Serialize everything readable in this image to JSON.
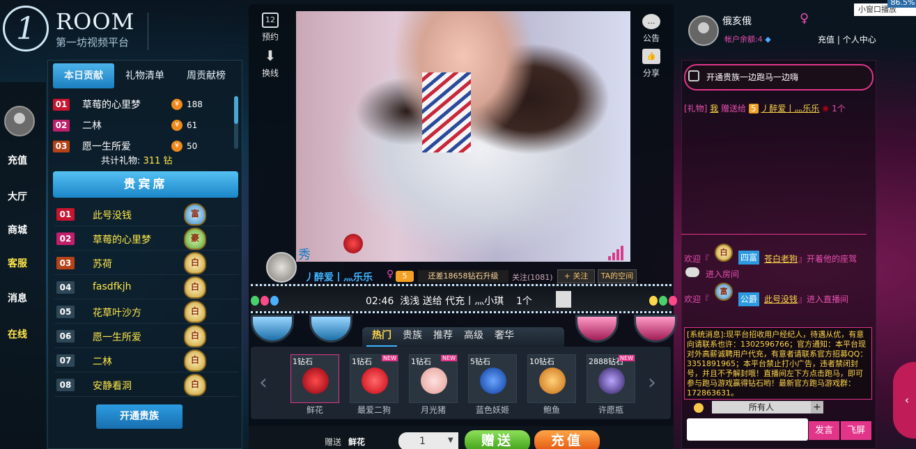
{
  "browser": {
    "zoom": "86.5%",
    "float_btn": "小窗口播放"
  },
  "brand": {
    "logo_mark": "1",
    "title": "ROOM",
    "subtitle": "第一坊视频平台"
  },
  "leftnav": [
    "充值",
    "大厅",
    "商城",
    "客服",
    "消息",
    "在线"
  ],
  "rank_tabs": [
    "本日贡献",
    "礼物清单",
    "周贡献榜"
  ],
  "rank": [
    {
      "no": "01",
      "name": "草莓的心里梦",
      "coin": "¥",
      "amount": "188"
    },
    {
      "no": "02",
      "name": "二林",
      "coin": "¥",
      "amount": "61"
    },
    {
      "no": "03",
      "name": "愿一生所爱",
      "coin": "¥",
      "amount": "50"
    }
  ],
  "rank_total_label": "共计礼物:",
  "rank_total_value": "311 钻",
  "vip_title": "贵宾席",
  "vip": [
    {
      "no": "01",
      "name": "此号没钱",
      "badge": "富"
    },
    {
      "no": "02",
      "name": "草莓的心里梦",
      "badge": "豪"
    },
    {
      "no": "03",
      "name": "苏荷",
      "badge": "白"
    },
    {
      "no": "04",
      "name": "fasdfkjh",
      "badge": "白"
    },
    {
      "no": "05",
      "name": "花草叶沙方",
      "badge": "白"
    },
    {
      "no": "06",
      "name": "愿一生所爱",
      "badge": "白"
    },
    {
      "no": "07",
      "name": "二林",
      "badge": "白"
    },
    {
      "no": "08",
      "name": "安静看洞",
      "badge": "白"
    }
  ],
  "open_clan": "开通贵族",
  "center_tools": {
    "book": "预约",
    "book_icon": "12",
    "switch": "换线",
    "notice": "公告",
    "share": "分享"
  },
  "host": {
    "xiu": "秀",
    "name": "丿醉爱丨灬乐乐",
    "sex": "♀",
    "level": "5",
    "upgrade": "还差18658钻石升级",
    "follow_count": "关注(1081)",
    "follow": "+ 关注",
    "space": "TA的空间"
  },
  "ticker": {
    "time": "02:46",
    "text": "浅浅 送给 代充丨灬小琪",
    "count": "1个"
  },
  "gift_tabs": [
    "热门",
    "贵族",
    "推荐",
    "高级",
    "奢华"
  ],
  "gifts": [
    {
      "price": "1钻石",
      "name": "鲜花",
      "new": "",
      "color": "#c8142e"
    },
    {
      "price": "1钻石",
      "name": "最爱二狗",
      "new": "NEW",
      "color": "#e8182e"
    },
    {
      "price": "1钻石",
      "name": "月光猪",
      "new": "NEW",
      "color": "#f5b7b0"
    },
    {
      "price": "5钻石",
      "name": "蓝色妖姬",
      "new": "",
      "color": "#1a5fd8"
    },
    {
      "price": "10钻石",
      "name": "鲍鱼",
      "new": "",
      "color": "#f0a030"
    },
    {
      "price": "2888钻石",
      "name": "许愿瓶",
      "new": "NEW",
      "color": "#5a3c8c"
    }
  ],
  "send": {
    "label": "赠送",
    "gift": "鲜花",
    "qty": "1",
    "send_btn": "赠送",
    "recharge_btn": "充值"
  },
  "user": {
    "name": "俄亥俄",
    "sex": "♀",
    "balance": "帐户余额:4",
    "recharge": "充值",
    "center": "个人中心"
  },
  "announce": "开通贵族一边跑马一边嗨",
  "chat_gift": {
    "tag": "[礼物]",
    "sender": "我",
    "verb": "赠送给",
    "level": "5",
    "receiver": "丿醉爱丨灬乐乐",
    "count": "1个"
  },
  "chat_welcome": [
    {
      "pre": "欢迎『",
      "badge": "白",
      "chip": "四富",
      "user": "苍白老狗",
      "post": "』开着他的座驾",
      "line2": "进入房间"
    },
    {
      "pre": "欢迎『",
      "badge": "富",
      "chip": "公爵",
      "user": "此号没钱",
      "post": "』进入直播间"
    }
  ],
  "sys_msg": "[系统消息]:现平台招收用户经纪人，待遇从优，有意向请联系也许：1302596766；官方通知：本平台现对外高薪诚聘用户代充，有意者请联系官方招募QQ：3351891965；本平台禁止打小广告，违者禁闭封号，并且不予解封哦！直播间左下方点击跑马，即可参与跑马游戏赢得钻石哟！最新官方跑马游戏群：172863631。",
  "chat_to": "所有人",
  "chat_plus": "+",
  "fayan": "发言",
  "feiping": "飞屏"
}
